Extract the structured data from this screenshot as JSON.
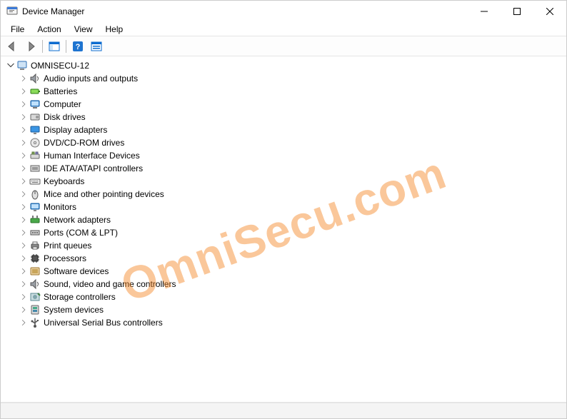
{
  "window": {
    "title": "Device Manager"
  },
  "menu": {
    "file": "File",
    "action": "Action",
    "view": "View",
    "help": "Help"
  },
  "tree": {
    "root": {
      "label": "OMNISECU-12",
      "expanded": true
    },
    "items": [
      {
        "icon": "audio-icon",
        "label": "Audio inputs and outputs"
      },
      {
        "icon": "battery-icon",
        "label": "Batteries"
      },
      {
        "icon": "computer-icon",
        "label": "Computer"
      },
      {
        "icon": "disk-icon",
        "label": "Disk drives"
      },
      {
        "icon": "display-icon",
        "label": "Display adapters"
      },
      {
        "icon": "dvd-icon",
        "label": "DVD/CD-ROM drives"
      },
      {
        "icon": "hid-icon",
        "label": "Human Interface Devices"
      },
      {
        "icon": "ide-icon",
        "label": "IDE ATA/ATAPI controllers"
      },
      {
        "icon": "keyboard-icon",
        "label": "Keyboards"
      },
      {
        "icon": "mouse-icon",
        "label": "Mice and other pointing devices"
      },
      {
        "icon": "monitor-icon",
        "label": "Monitors"
      },
      {
        "icon": "network-icon",
        "label": "Network adapters"
      },
      {
        "icon": "ports-icon",
        "label": "Ports (COM & LPT)"
      },
      {
        "icon": "printer-icon",
        "label": "Print queues"
      },
      {
        "icon": "processor-icon",
        "label": "Processors"
      },
      {
        "icon": "software-icon",
        "label": "Software devices"
      },
      {
        "icon": "sound-icon",
        "label": "Sound, video and game controllers"
      },
      {
        "icon": "storage-icon",
        "label": "Storage controllers"
      },
      {
        "icon": "system-icon",
        "label": "System devices"
      },
      {
        "icon": "usb-icon",
        "label": "Universal Serial Bus controllers"
      }
    ]
  },
  "watermark": "OmniSecu.com"
}
